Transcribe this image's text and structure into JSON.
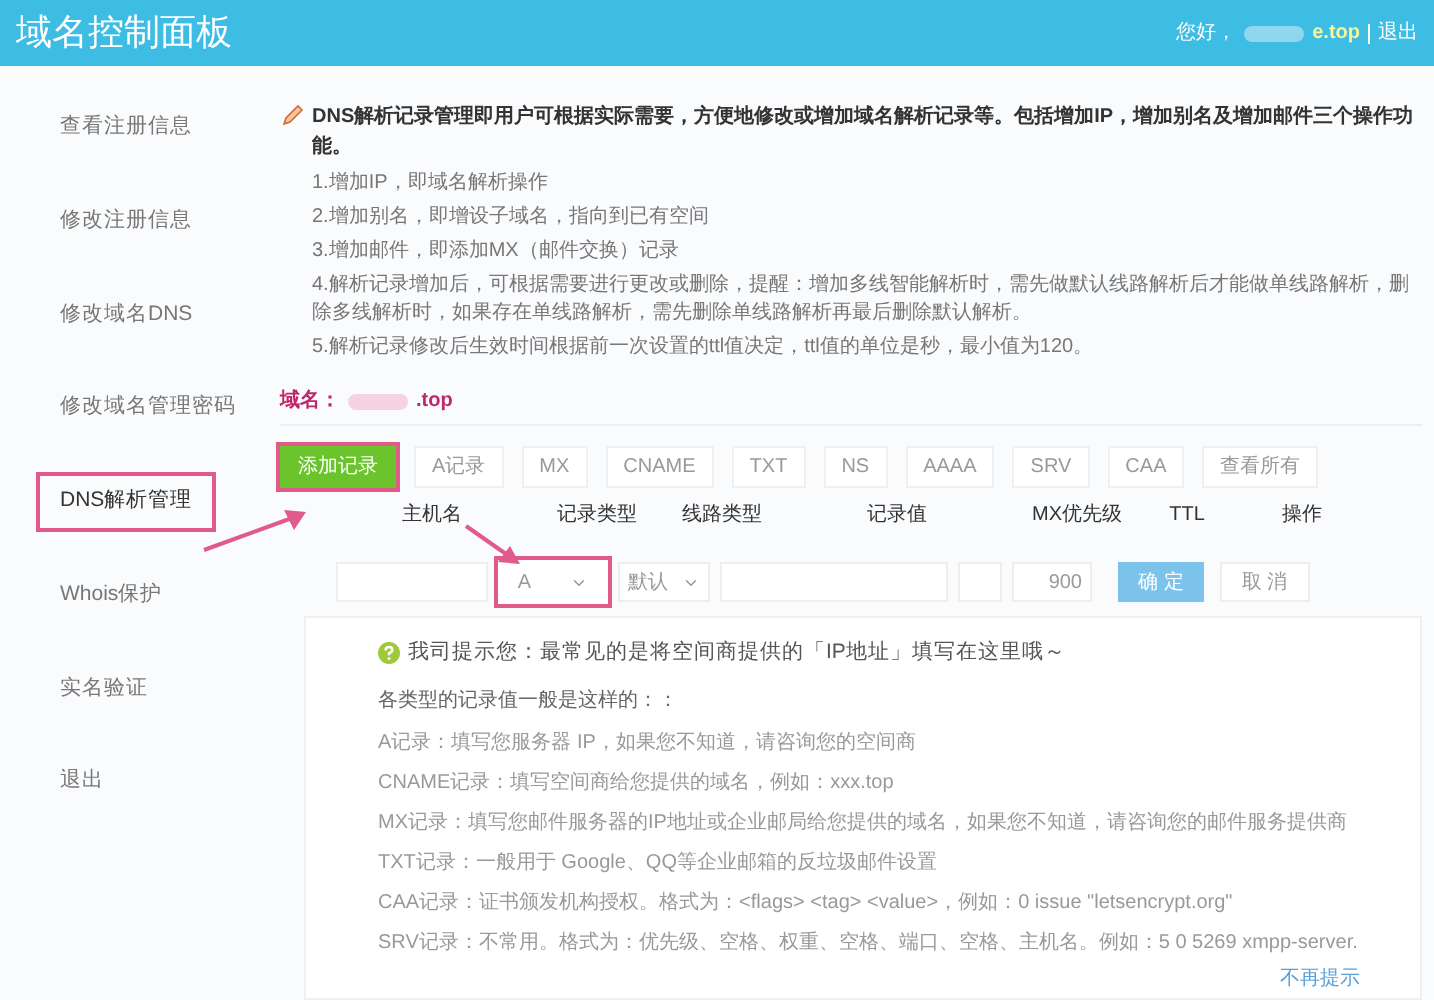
{
  "header": {
    "title": "域名控制面板",
    "greeting": "您好，",
    "user_domain": "e.top",
    "logout": "退出"
  },
  "sidebar": {
    "items": [
      {
        "label": "查看注册信息",
        "selected": false,
        "annotated": false
      },
      {
        "label": "修改注册信息",
        "selected": false,
        "annotated": false
      },
      {
        "label": "修改域名DNS",
        "selected": false,
        "annotated": false
      },
      {
        "label": "修改域名管理密码",
        "selected": false,
        "annotated": false
      },
      {
        "label": "DNS解析管理",
        "selected": true,
        "annotated": true
      },
      {
        "label": "Whois保护",
        "selected": false,
        "annotated": false
      },
      {
        "label": "实名验证",
        "selected": false,
        "annotated": false
      },
      {
        "label": "退出",
        "selected": false,
        "annotated": false
      }
    ]
  },
  "intro": {
    "lead": "DNS解析记录管理即用户可根据实际需要，方便地修改或增加域名解析记录等。包括增加IP，增加别名及增加邮件三个操作功能。",
    "points": [
      "1.增加IP，即域名解析操作",
      "2.增加别名，即增设子域名，指向到已有空间",
      "3.增加邮件，即添加MX（邮件交换）记录",
      "4.解析记录增加后，可根据需要进行更改或删除，提醒：增加多线智能解析时，需先做默认线路解析后才能做单线路解析，删除多线解析时，如果存在单线路解析，需先删除单线路解析再最后删除默认解析。",
      "5.解析记录修改后生效时间根据前一次设置的ttl值决定，ttl值的单位是秒，最小值为120。"
    ]
  },
  "domain": {
    "label": "域名：",
    "value": ".top"
  },
  "record_tabs": [
    {
      "label": "添加记录",
      "kind": "action",
      "annotated": true
    },
    {
      "label": "A记录",
      "kind": "filter",
      "annotated": false
    },
    {
      "label": "MX",
      "kind": "filter",
      "annotated": false
    },
    {
      "label": "CNAME",
      "kind": "filter",
      "annotated": false
    },
    {
      "label": "TXT",
      "kind": "filter",
      "annotated": false
    },
    {
      "label": "NS",
      "kind": "filter",
      "annotated": false
    },
    {
      "label": "AAAA",
      "kind": "filter",
      "annotated": false
    },
    {
      "label": "SRV",
      "kind": "filter",
      "annotated": false
    },
    {
      "label": "CAA",
      "kind": "filter",
      "annotated": false
    },
    {
      "label": "查看所有",
      "kind": "filter",
      "annotated": false
    }
  ],
  "form": {
    "columns": [
      "主机名",
      "记录类型",
      "线路类型",
      "记录值",
      "MX优先级",
      "TTL",
      "操作"
    ],
    "record_type": {
      "value": "A",
      "annotated": true
    },
    "line_type": {
      "value": "默认"
    },
    "ttl": {
      "value": "900"
    },
    "buttons": [
      {
        "label": "确 定",
        "kind": "primary"
      },
      {
        "label": "取 消",
        "kind": "secondary"
      }
    ]
  },
  "hint": {
    "title": "我司提示您：最常见的是将空间商提供的「IP地址」填写在这里哦～",
    "subtitle": "各类型的记录值一般是这样的：：",
    "lines": [
      "A记录：填写您服务器 IP，如果您不知道，请咨询您的空间商",
      "CNAME记录：填写空间商给您提供的域名，例如：xxx.top",
      "MX记录：填写您邮件服务器的IP地址或企业邮局给您提供的域名，如果您不知道，请咨询您的邮件服务提供商",
      "TXT记录：一般用于 Google、QQ等企业邮箱的反垃圾邮件设置",
      "CAA记录：证书颁发机构授权。格式为：<flags> <tag> <value>，例如：0 issue \"letsencrypt.org\"",
      "SRV记录：不常用。格式为：优先级、空格、权重、空格、端口、空格、主机名。例如：5 0 5269 xmpp-server."
    ],
    "dismiss": "不再提示"
  }
}
